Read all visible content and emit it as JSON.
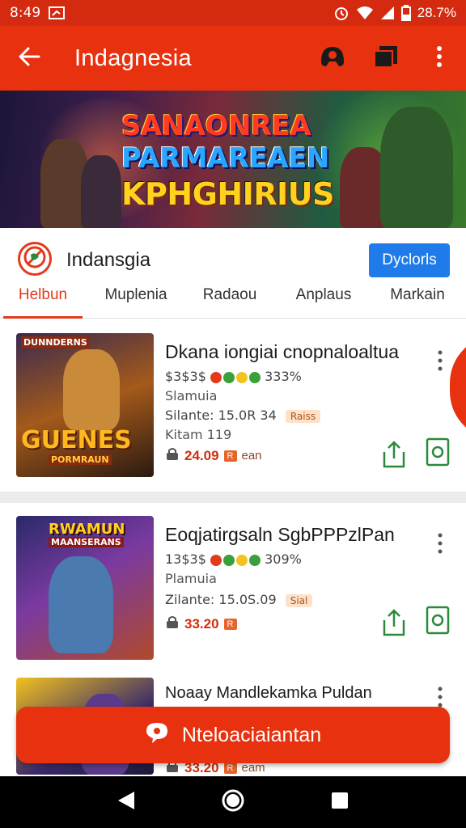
{
  "status_bar": {
    "time": "8:49",
    "battery": "28.7%",
    "icons": [
      "screenshot-icon",
      "alarm-icon",
      "wifi-icon",
      "signal-icon",
      "battery-icon"
    ]
  },
  "app_bar": {
    "title": "Indagnesia",
    "icons": [
      "back-arrow-icon",
      "game-controller-icon",
      "cast-icon",
      "more-vert-icon"
    ]
  },
  "banner": {
    "lines": [
      "SANAONREA",
      "PARMAREAEN",
      "KPHGHIRIUS"
    ]
  },
  "channel": {
    "name": "Indansgia",
    "follow_label": "Dyclorls",
    "tabs": [
      {
        "label": "Helbun",
        "active": true
      },
      {
        "label": "Muplenia",
        "active": false
      },
      {
        "label": "Radaou",
        "active": false
      },
      {
        "label": "Anplaus",
        "active": false
      },
      {
        "label": "Markain",
        "active": false
      }
    ]
  },
  "cards": [
    {
      "thumb_top": "DUNNDERNS",
      "thumb_bottom": "GUENES",
      "thumb_sub": "PORMRAUN",
      "title": "Dkana iongiai cnopnaloaltua",
      "rating_prefix": "$3$3$",
      "rating_value": "333%",
      "subtitle": "Slamuia",
      "stat_label": "Silante: 15.0R 34",
      "tag": "Raiss",
      "extra": "Kitam  119",
      "price": "24.09",
      "price_badge": "R",
      "price_unit": "ean"
    },
    {
      "thumb_top": "RWAMUN",
      "thumb_bottom": "MAANSERANS",
      "thumb_sub": "",
      "title": "Eoqjatirgsaln SgbPPPzlPan",
      "rating_prefix": "13$3$",
      "rating_value": "309%",
      "subtitle": "Plamuia",
      "stat_label": "Zilante: 15.0S.09",
      "tag": "Sial",
      "extra": "",
      "price": "33.20",
      "price_badge": "R",
      "price_unit": ""
    },
    {
      "thumb_top": "",
      "thumb_bottom": "",
      "thumb_sub": "",
      "title": "Noaay Mandlekamka Puldan",
      "rating_prefix": "",
      "rating_value": "",
      "subtitle": "",
      "stat_label": "",
      "tag": "",
      "extra": "",
      "price": "33.20",
      "price_badge": "R",
      "price_unit": "eam"
    }
  ],
  "fab": {
    "label": "Nteloaciaiantan",
    "icon": "chat-bubble-icon"
  },
  "nav_bar": {
    "icons": [
      "nav-back-icon",
      "nav-home-icon",
      "nav-recents-icon"
    ]
  },
  "colors": {
    "brand": "#e8320f",
    "accent_blue": "#1f7bea",
    "price": "#d32d0e",
    "action_green": "#2a8a3a"
  }
}
